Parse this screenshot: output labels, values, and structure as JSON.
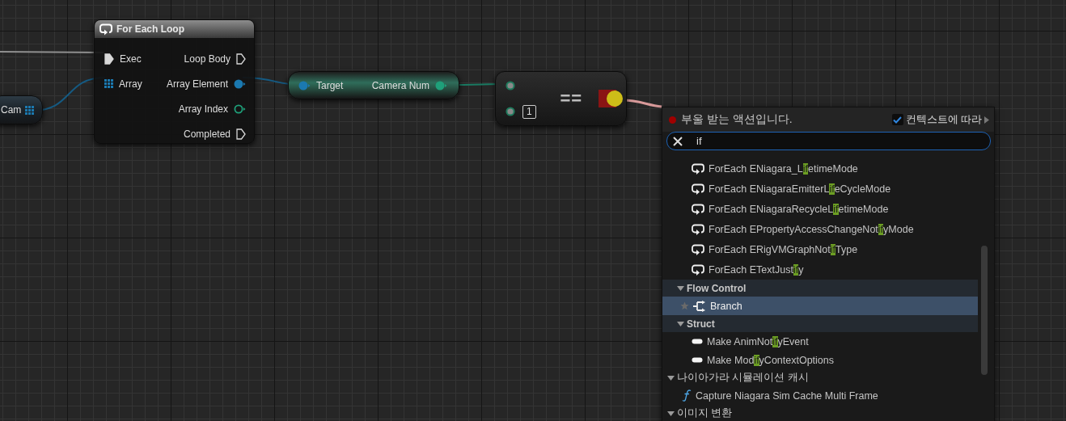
{
  "graph": {
    "nodes": [
      {
        "kind": "variable",
        "label": "Cam",
        "pin": {
          "kind": "array"
        }
      },
      {
        "kind": "function",
        "title": "For Each Loop",
        "inputs": [
          {
            "label": "Exec",
            "kind": "exec",
            "connected": true
          },
          {
            "label": "Array",
            "kind": "array"
          }
        ],
        "outputs": [
          {
            "label": "Loop Body",
            "kind": "exec",
            "connected": false
          },
          {
            "label": "Array Element",
            "kind": "object",
            "connected": true
          },
          {
            "label": "Array Index",
            "kind": "int",
            "connected": false
          },
          {
            "label": "Completed",
            "kind": "exec",
            "connected": false
          }
        ]
      },
      {
        "kind": "pure",
        "input": {
          "label": "Target",
          "kind": "object",
          "connected": true
        },
        "output": {
          "label": "Camera Num",
          "kind": "int",
          "connected": true
        }
      },
      {
        "kind": "operator",
        "operator": "==",
        "inputs": [
          {
            "kind": "operand"
          },
          {
            "kind": "operand",
            "value": "1"
          }
        ],
        "output": {
          "kind": "bool",
          "highlighted": true
        }
      }
    ]
  },
  "action_menu": {
    "title": "부울 받는 액션입니다.",
    "context_checkbox": {
      "label": "컨텍스트에 따라",
      "checked": true
    },
    "search": {
      "value": "if"
    },
    "results": [
      {
        "kind": "group",
        "children": [
          {
            "kind": "group",
            "children": [
              {
                "kind": "loop_action",
                "label": "ForEach ENiagara_LifetimeMode",
                "selected": false
              },
              {
                "kind": "loop_action",
                "label": "ForEach ENiagaraEmitterLifeCycleMode",
                "selected": false
              },
              {
                "kind": "loop_action",
                "label": "ForEach ENiagaraRecycleLifetimeMode",
                "selected": false
              },
              {
                "kind": "loop_action",
                "label": "ForEach EPropertyAccessChangeNotifyMode",
                "selected": false
              },
              {
                "kind": "loop_action",
                "label": "ForEach ERigVMGraphNotifType",
                "selected": false
              },
              {
                "kind": "loop_action",
                "label": "ForEach ETextJustify",
                "selected": false
              }
            ]
          },
          {
            "kind": "category",
            "label": "Flow Control",
            "expanded": true,
            "children": [
              {
                "kind": "branch_action",
                "label": "Branch",
                "selected": true
              }
            ]
          },
          {
            "kind": "category",
            "label": "Struct",
            "expanded": true,
            "children": [
              {
                "kind": "struct_action",
                "label": "Make AnimNotifyEvent",
                "selected": false
              },
              {
                "kind": "struct_action",
                "label": "Make ModifyContextOptions",
                "selected": false
              }
            ]
          }
        ]
      },
      {
        "kind": "category",
        "label": "나이아가라 시뮬레이션 캐시",
        "expanded": true,
        "children": [
          {
            "kind": "function_action",
            "label": "Capture Niagara Sim Cache Multi Frame",
            "selected": false
          }
        ]
      },
      {
        "kind": "category",
        "label": "이미지 변환",
        "expanded": true
      }
    ]
  }
}
